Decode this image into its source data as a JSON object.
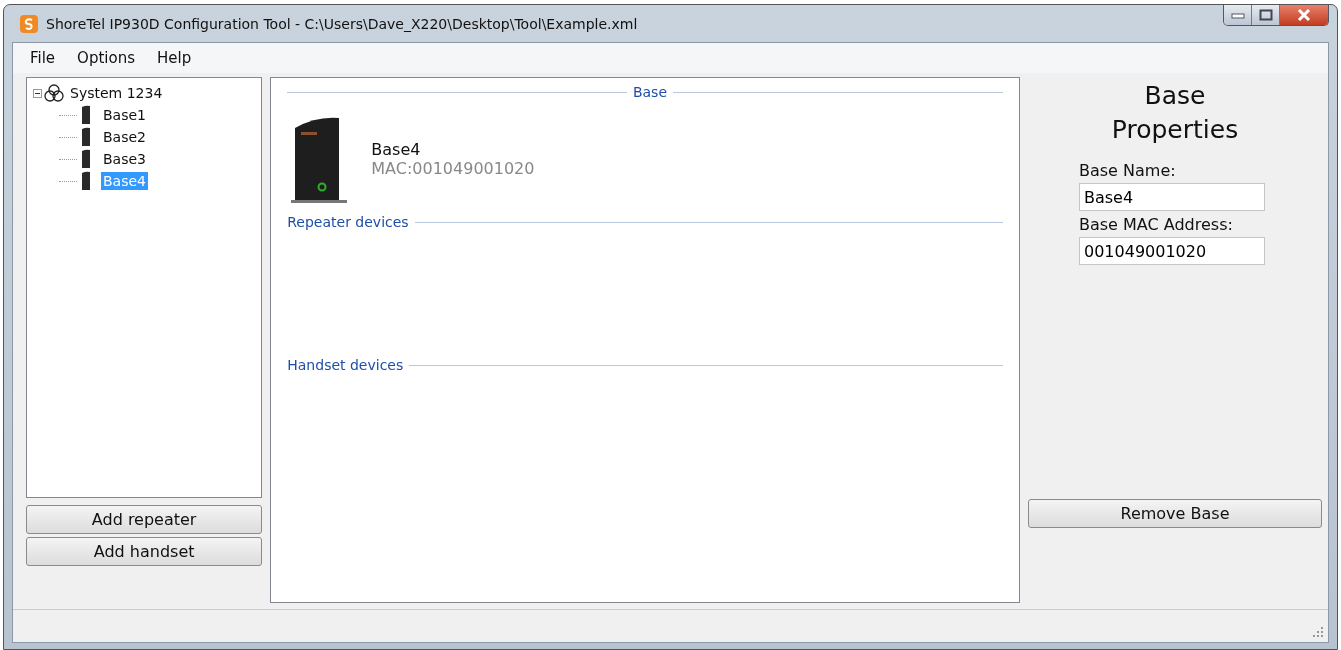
{
  "window": {
    "title": "ShoreTel IP930D Configuration Tool - C:\\Users\\Dave_X220\\Desktop\\Tool\\Example.xml"
  },
  "menu": [
    "File",
    "Options",
    "Help"
  ],
  "tree": {
    "label": "System 1234",
    "expanded": true,
    "children": [
      {
        "label": "Base1",
        "selected": false
      },
      {
        "label": "Base2",
        "selected": false
      },
      {
        "label": "Base3",
        "selected": false
      },
      {
        "label": "Base4",
        "selected": true
      }
    ]
  },
  "left_buttons": [
    "Add repeater",
    "Add handset"
  ],
  "base_section": {
    "title": "Base",
    "name": "Base4",
    "mac": "MAC:001049001020"
  },
  "sections": [
    "Repeater devices",
    "Handset devices"
  ],
  "properties": {
    "title": "Base Properties",
    "fields": [
      {
        "label": "Base Name:",
        "value": "Base4"
      },
      {
        "label": "Base MAC Address:",
        "value": "001049001020"
      }
    ],
    "button": "Remove Base"
  }
}
